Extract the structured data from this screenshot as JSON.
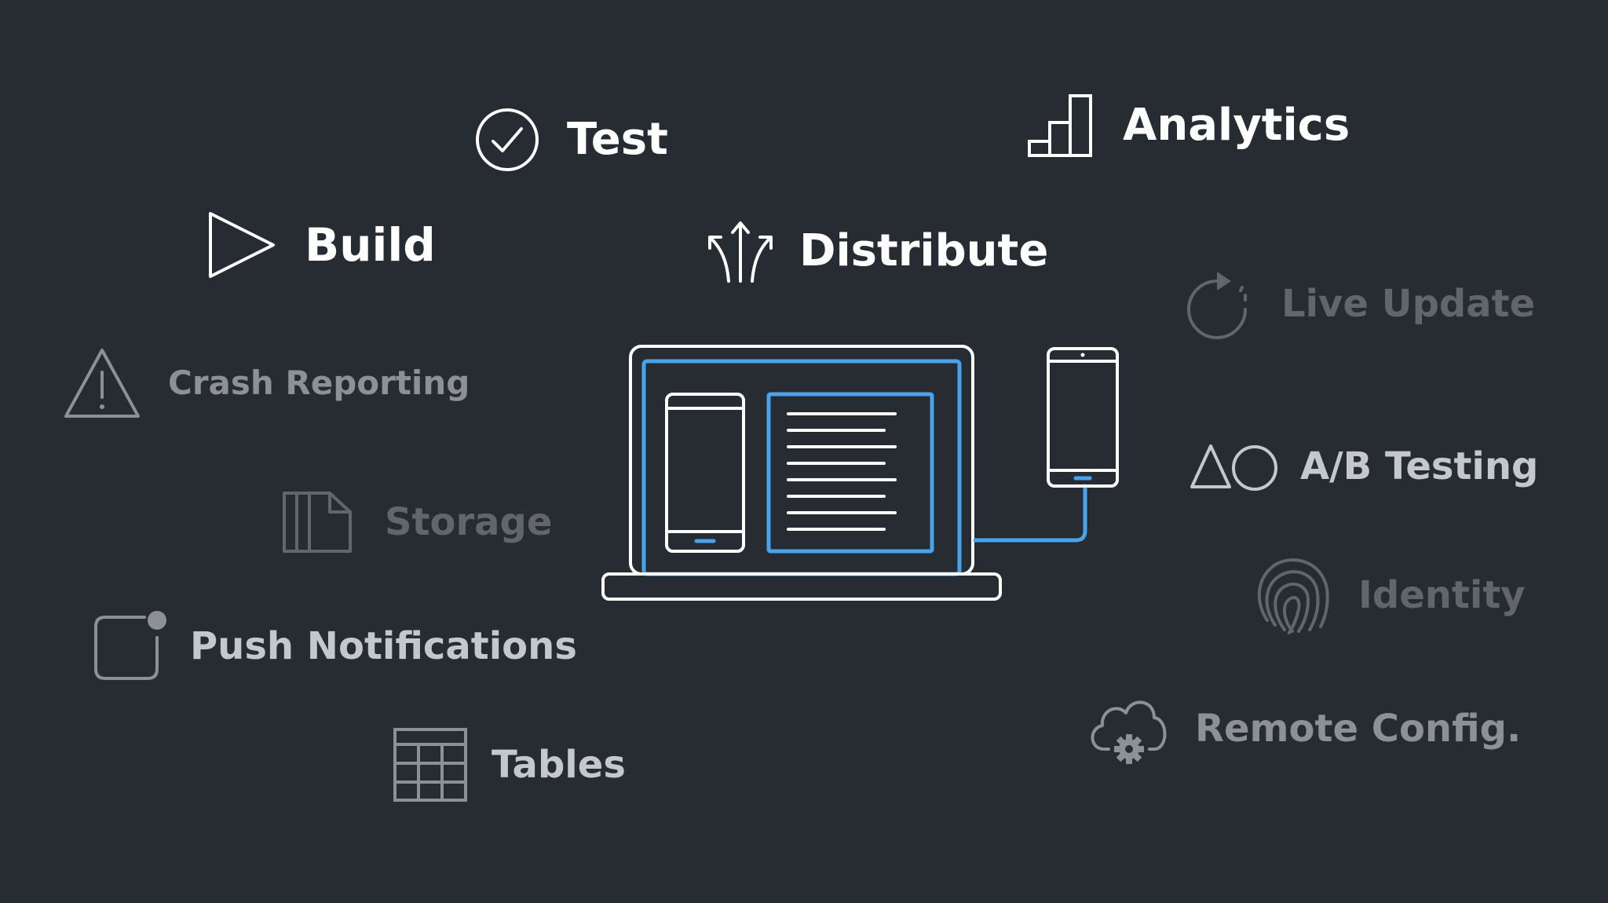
{
  "colors": {
    "background": "#272c33",
    "primary": "#ffffff",
    "accent": "#4aa3ea",
    "secondary": "#c4c7cc",
    "muted": "#8d9197",
    "faint": "#62666c"
  },
  "features": {
    "test": {
      "label": "Test",
      "icon": "check-circle-icon"
    },
    "analytics": {
      "label": "Analytics",
      "icon": "bar-chart-icon"
    },
    "build": {
      "label": "Build",
      "icon": "play-icon"
    },
    "distribute": {
      "label": "Distribute",
      "icon": "split-arrows-icon"
    },
    "live_update": {
      "label": "Live Update",
      "icon": "refresh-icon"
    },
    "crash_reporting": {
      "label": "Crash Reporting",
      "icon": "warning-icon"
    },
    "ab_testing": {
      "label": "A/B Testing",
      "icon": "triangle-circle-icon"
    },
    "storage": {
      "label": "Storage",
      "icon": "storage-icon"
    },
    "identity": {
      "label": "Identity",
      "icon": "fingerprint-icon"
    },
    "push_notifications": {
      "label": "Push Notifications",
      "icon": "notification-badge-icon"
    },
    "remote_config": {
      "label": "Remote Config.",
      "icon": "cloud-gear-icon"
    },
    "tables": {
      "label": "Tables",
      "icon": "grid-table-icon"
    }
  },
  "hero": {
    "icon": "laptop-with-phones-icon"
  }
}
